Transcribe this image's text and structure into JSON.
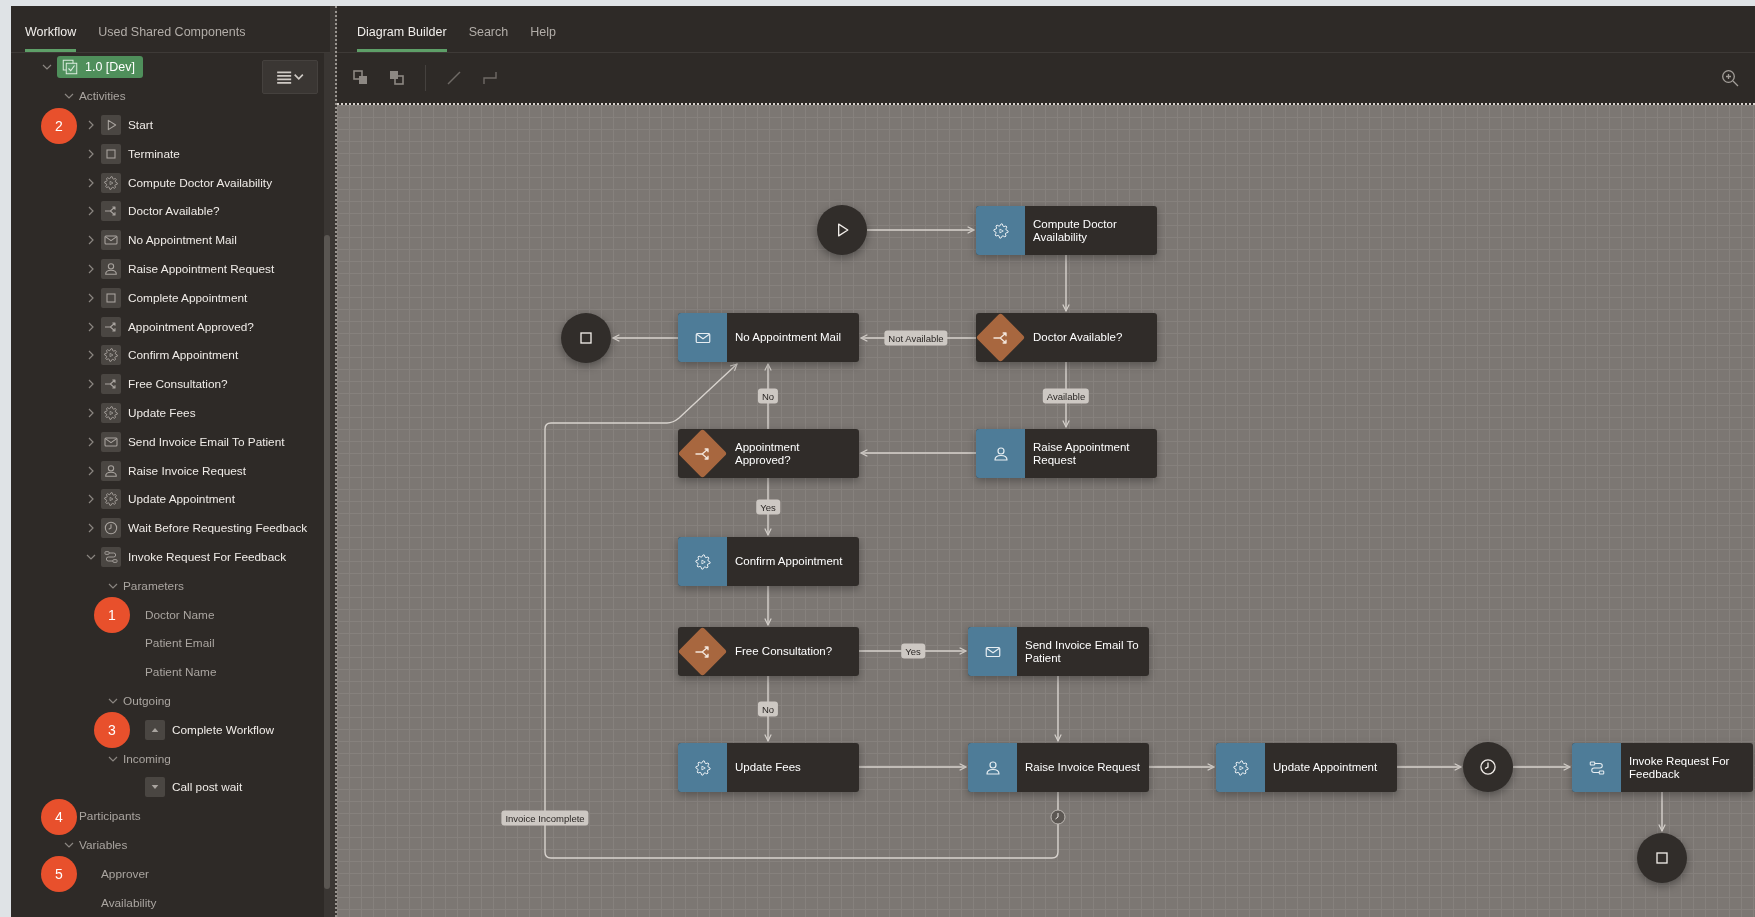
{
  "left_tabs": [
    {
      "label": "Workflow",
      "selected": true
    },
    {
      "label": "Used Shared Components",
      "selected": false
    }
  ],
  "tree": [
    {
      "label": "1.0 [Dev]",
      "kind": "version",
      "expanded": true,
      "children": [
        {
          "label": "Activities",
          "kind": "folder",
          "expanded": true,
          "children": [
            {
              "label": "Start",
              "kind": "start",
              "expanded": false,
              "badge": "2"
            },
            {
              "label": "Terminate",
              "kind": "end",
              "expanded": false
            },
            {
              "label": "Compute Doctor Availability",
              "kind": "service",
              "expanded": false
            },
            {
              "label": "Doctor Available?",
              "kind": "decision",
              "expanded": false
            },
            {
              "label": "No Appointment Mail",
              "kind": "mail",
              "expanded": false
            },
            {
              "label": "Raise Appointment Request",
              "kind": "human",
              "expanded": false
            },
            {
              "label": "Complete Appointment",
              "kind": "end",
              "expanded": false
            },
            {
              "label": "Appointment Approved?",
              "kind": "decision",
              "expanded": false
            },
            {
              "label": "Confirm Appointment",
              "kind": "service",
              "expanded": false
            },
            {
              "label": "Free Consultation?",
              "kind": "decision",
              "expanded": false
            },
            {
              "label": "Update Fees",
              "kind": "service",
              "expanded": false
            },
            {
              "label": "Send Invoice Email To Patient",
              "kind": "mail",
              "expanded": false
            },
            {
              "label": "Raise Invoice Request",
              "kind": "human",
              "expanded": false
            },
            {
              "label": "Update Appointment",
              "kind": "service",
              "expanded": false
            },
            {
              "label": "Wait Before Requesting Feedback",
              "kind": "timer",
              "expanded": false
            },
            {
              "label": "Invoke Request For Feedback",
              "kind": "invoke",
              "expanded": true,
              "children": [
                {
                  "label": "Parameters",
                  "kind": "folder",
                  "expanded": true,
                  "children": [
                    {
                      "label": "Doctor Name",
                      "kind": "plain",
                      "badge": "1"
                    },
                    {
                      "label": "Patient Email",
                      "kind": "plain"
                    },
                    {
                      "label": "Patient Name",
                      "kind": "plain"
                    }
                  ]
                },
                {
                  "label": "Outgoing",
                  "kind": "folder",
                  "expanded": true,
                  "children": [
                    {
                      "label": "Complete Workflow",
                      "kind": "outgoing",
                      "badge": "3"
                    }
                  ]
                },
                {
                  "label": "Incoming",
                  "kind": "folder",
                  "expanded": true,
                  "children": [
                    {
                      "label": "Call post wait",
                      "kind": "incoming"
                    }
                  ]
                }
              ]
            }
          ]
        },
        {
          "label": "Participants",
          "kind": "folder",
          "badge": "4"
        },
        {
          "label": "Variables",
          "kind": "folder",
          "expanded": true,
          "children": [
            {
              "label": "Approver",
              "kind": "plain",
              "badge": "5"
            },
            {
              "label": "Availability",
              "kind": "plain"
            }
          ]
        }
      ]
    }
  ],
  "right_tabs": [
    {
      "label": "Diagram Builder",
      "selected": true
    },
    {
      "label": "Search",
      "selected": false
    },
    {
      "label": "Help",
      "selected": false
    }
  ],
  "diagram": {
    "nodes": [
      {
        "kind": "start"
      },
      {
        "kind": "service",
        "label": "Compute Doctor Availability"
      },
      {
        "kind": "end"
      },
      {
        "kind": "mail",
        "label": "No Appointment Mail"
      },
      {
        "kind": "decision",
        "label": "Doctor Available?"
      },
      {
        "kind": "decision",
        "label": "Appointment Approved?"
      },
      {
        "kind": "human",
        "label": "Raise Appointment Request"
      },
      {
        "kind": "service",
        "label": "Confirm Appointment"
      },
      {
        "kind": "decision",
        "label": "Free Consultation?"
      },
      {
        "kind": "mail",
        "label": "Send Invoice Email To Patient"
      },
      {
        "kind": "service",
        "label": "Update Fees"
      },
      {
        "kind": "human",
        "label": "Raise Invoice Request"
      },
      {
        "kind": "service",
        "label": "Update Appointment"
      },
      {
        "kind": "timer"
      },
      {
        "kind": "invoke",
        "label": "Invoke Request For Feedback"
      },
      {
        "kind": "end"
      }
    ],
    "edge_labels": [
      "Not Available",
      "Available",
      "No",
      "Yes",
      "Yes",
      "No",
      "Invoice Incomplete"
    ]
  }
}
